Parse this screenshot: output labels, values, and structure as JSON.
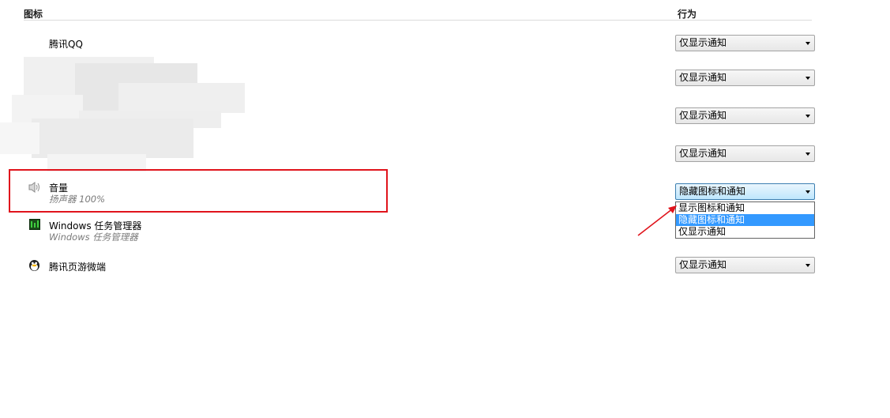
{
  "columns": {
    "icon": "图标",
    "behavior": "行为"
  },
  "rows": [
    {
      "name": "腾讯QQ",
      "behavior": "仅显示通知"
    },
    {
      "name": "",
      "behavior": "仅显示通知"
    },
    {
      "name": "",
      "behavior": "仅显示通知"
    },
    {
      "name": "",
      "behavior": "仅显示通知"
    },
    {
      "name": "音量",
      "subtitle": "扬声器 100%",
      "behavior": "隐藏图标和通知"
    },
    {
      "name": "Windows 任务管理器",
      "subtitle": "Windows 任务管理器",
      "behavior": ""
    },
    {
      "name": "腾讯页游微端",
      "behavior": "仅显示通知"
    }
  ],
  "dropdown_options": [
    "显示图标和通知",
    "隐藏图标和通知",
    "仅显示通知"
  ],
  "dropdown_selected_index": 1,
  "colors": {
    "highlight_box": "#e0141c",
    "arrow": "#e0141c",
    "selection": "#3399ff"
  },
  "icons": [
    "speaker-icon",
    "task-manager-icon",
    "qq-penguin-icon"
  ]
}
